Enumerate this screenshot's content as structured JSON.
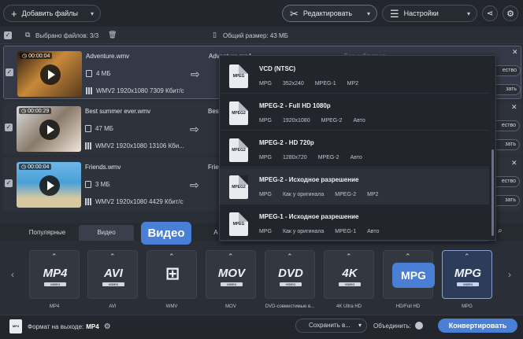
{
  "toolbar": {
    "add_files": "Добавить файлы",
    "edit": "Редактировать",
    "settings": "Настройки"
  },
  "info": {
    "selected": "Выбрано файлов: 3/3",
    "total_size": "Общий размер: 43 МБ"
  },
  "files": [
    {
      "duration": "00:00:04",
      "name": "Adventure.wmv",
      "size": "4 МБ",
      "info": "WMV2 1920x1080 7309 Кбит/с",
      "output": "Adventure.mp4",
      "subtitle": "Без субтитров",
      "btn1": "ество",
      "btn2": "зать"
    },
    {
      "duration": "00:00:29",
      "name": "Best summer ever.wmv",
      "size": "47 МБ",
      "info": "WMV2 1920x1080 13106 Кби...",
      "output": "Bes",
      "btn1": "ество",
      "btn2": "зать"
    },
    {
      "duration": "00:00:04",
      "name": "Friends.wmv",
      "size": "3 МБ",
      "info": "WMV2 1920x1080 4429 Кбит/с",
      "output": "Frie",
      "btn1": "ество",
      "btn2": "зать"
    }
  ],
  "dropdown": [
    {
      "icon": "MPEG",
      "title": "VCD (NTSC)",
      "specs": [
        "MPG",
        "352x240",
        "MPEG-1",
        "MP2"
      ]
    },
    {
      "icon": "MPEG2",
      "title": "MPEG-2 - Full HD 1080p",
      "specs": [
        "MPG",
        "1920x1080",
        "MPEG-2",
        "Авто"
      ]
    },
    {
      "icon": "MPEG2",
      "title": "MPEG-2 - HD 720p",
      "specs": [
        "MPG",
        "1280x720",
        "MPEG-2",
        "Авто"
      ]
    },
    {
      "icon": "MPEG2",
      "title": "MPEG-2  - Исходное разрешение",
      "specs": [
        "MPG",
        "Как у оригинала",
        "MPEG-2",
        "MP2"
      ]
    },
    {
      "icon": "MPEG",
      "title": "MPEG-1  - Исходное разрешение",
      "specs": [
        "MPG",
        "Как у оригинала",
        "MPEG-1",
        "Авто"
      ]
    }
  ],
  "tabs": {
    "popular": "Популярные",
    "video": "Видео",
    "audio": "А"
  },
  "callouts": {
    "video": "Видео",
    "mpg": "MPG"
  },
  "formats": [
    {
      "logo": "MP4",
      "label": "MP4"
    },
    {
      "logo": "AVI",
      "label": "AVI"
    },
    {
      "logo": "⊞",
      "label": "WMV"
    },
    {
      "logo": "MOV",
      "label": "MOV"
    },
    {
      "logo": "DVD",
      "label": "DVD-совместимые в..."
    },
    {
      "logo": "4K",
      "label": "4K Ultra HD"
    },
    {
      "logo": "",
      "label": "HD/Full HD"
    },
    {
      "logo": "MPG",
      "label": "MPG"
    }
  ],
  "bottom": {
    "output_label": "Формат на выходе:",
    "output_value": "MP4",
    "save": "Сохранить в...",
    "merge": "Объединить:",
    "convert": "Конвертировать"
  },
  "video_badge": "VIDEO",
  "colors": {
    "accent": "#4a7fd6",
    "background": "#2a2e37"
  }
}
